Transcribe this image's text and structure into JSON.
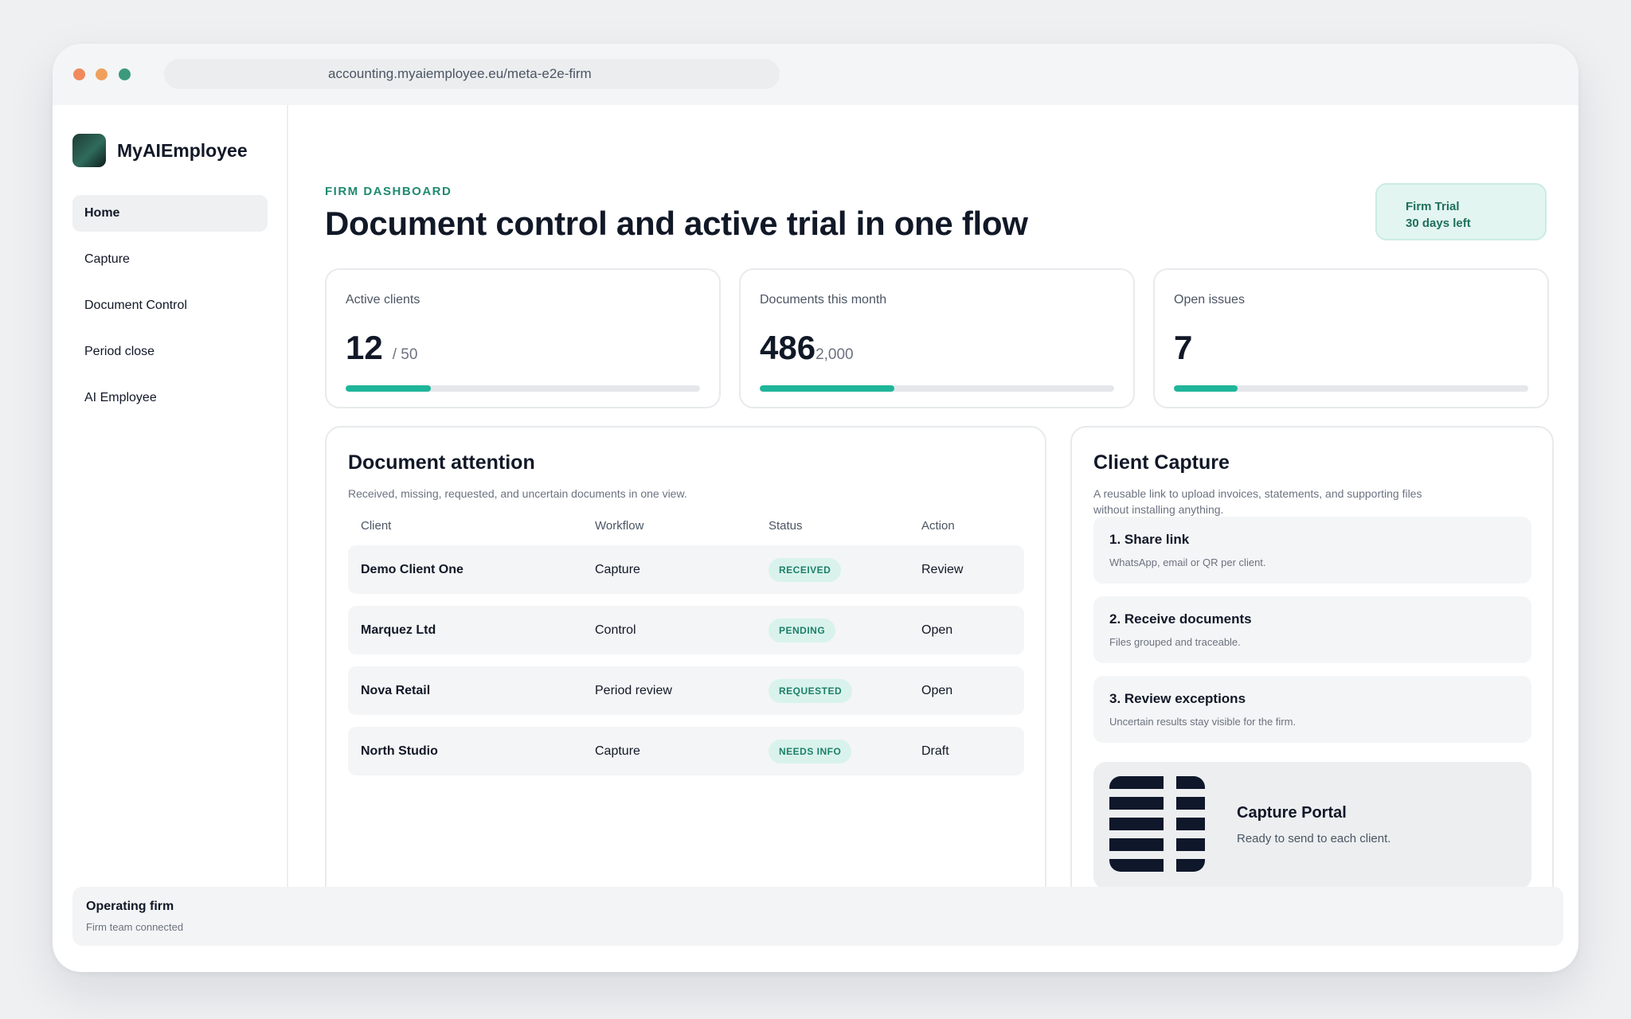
{
  "browser": {
    "url": "accounting.myaiemployee.eu/meta-e2e-firm"
  },
  "sidebar": {
    "brand": "MyAIEmployee",
    "items": [
      {
        "label": "Home",
        "active": true
      },
      {
        "label": "Capture"
      },
      {
        "label": "Document Control"
      },
      {
        "label": "Period close"
      },
      {
        "label": "AI Employee"
      }
    ]
  },
  "header": {
    "eyebrow": "FIRM DASHBOARD",
    "title": "Document control and active trial in one flow",
    "trial_line1": "Firm Trial",
    "trial_line2": "30 days left"
  },
  "stats": [
    {
      "label": "Active clients",
      "value": "12",
      "suffix": "/ 50",
      "progress": 0.24
    },
    {
      "label": "Documents this month",
      "value": "486",
      "suffix": "2,000",
      "progress": 0.38
    },
    {
      "label": "Open issues",
      "value": "7",
      "suffix": "",
      "progress": 0.18
    }
  ],
  "attention": {
    "title": "Document attention",
    "subtitle": "Received, missing, requested, and uncertain documents in one view.",
    "columns": [
      "Client",
      "Workflow",
      "Status",
      "Action"
    ],
    "rows": [
      {
        "client": "Demo Client One",
        "workflow": "Capture",
        "status": "RECEIVED",
        "action": "Review"
      },
      {
        "client": "Marquez Ltd",
        "workflow": "Control",
        "status": "PENDING",
        "action": "Open"
      },
      {
        "client": "Nova Retail",
        "workflow": "Period review",
        "status": "REQUESTED",
        "action": "Open"
      },
      {
        "client": "North Studio",
        "workflow": "Capture",
        "status": "NEEDS INFO",
        "action": "Draft"
      }
    ]
  },
  "capture": {
    "title": "Client Capture",
    "subtitle_line1": "A reusable link to upload invoices, statements, and supporting files",
    "subtitle_line2": "without installing anything.",
    "steps": [
      {
        "title": "1. Share link",
        "subtitle": "WhatsApp, email or QR per client."
      },
      {
        "title": "2. Receive documents",
        "subtitle": "Files grouped and traceable."
      },
      {
        "title": "3. Review exceptions",
        "subtitle": "Uncertain results stay visible for the firm."
      }
    ],
    "portal_title": "Capture Portal",
    "portal_subtitle": "Ready to send to each client.",
    "portal_icon": "grid-portal-icon"
  },
  "footer": {
    "title": "Operating firm",
    "subtitle": "Firm team connected"
  },
  "colors": {
    "accent": "#1fb59a",
    "accent_dark": "#1f8a70",
    "pill_bg": "#d9f3ec",
    "pill_text": "#1d7f68"
  }
}
